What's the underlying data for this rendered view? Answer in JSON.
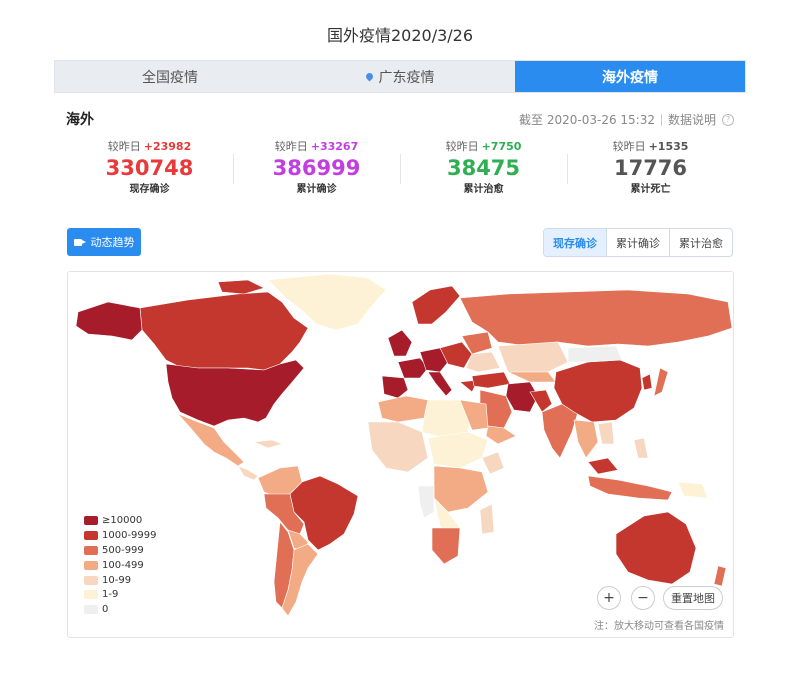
{
  "page_title": "国外疫情2020/3/26",
  "tabs": [
    {
      "label": "全国疫情",
      "active": false
    },
    {
      "label": "广东疫情",
      "active": false,
      "icon": "location-pin-icon"
    },
    {
      "label": "海外疫情",
      "active": true
    }
  ],
  "region_label": "海外",
  "as_of": "截至 2020-03-26 15:32",
  "data_note_link": "数据说明",
  "stats": [
    {
      "change_label": "较昨日",
      "change": "+23982",
      "value": "330748",
      "label": "现存确诊",
      "color": "#e83a3a"
    },
    {
      "change_label": "较昨日",
      "change": "+33267",
      "value": "386999",
      "label": "累计确诊",
      "color": "#c23ee0"
    },
    {
      "change_label": "较昨日",
      "change": "+7750",
      "value": "38475",
      "label": "累计治愈",
      "color": "#2fae52"
    },
    {
      "change_label": "较昨日",
      "change": "+1535",
      "value": "17776",
      "label": "累计死亡",
      "color": "#555555"
    }
  ],
  "trend_button": {
    "label": "动态趋势",
    "icon": "video-camera-icon"
  },
  "map_toggle": [
    {
      "label": "现存确诊",
      "active": true
    },
    {
      "label": "累计确诊",
      "active": false
    },
    {
      "label": "累计治愈",
      "active": false
    }
  ],
  "legend": [
    {
      "label": "≥10000",
      "color": "#a61c2b"
    },
    {
      "label": "1000-9999",
      "color": "#c3372f"
    },
    {
      "label": "500-999",
      "color": "#e06f55"
    },
    {
      "label": "100-499",
      "color": "#f2ab84"
    },
    {
      "label": "10-99",
      "color": "#f7d7c0"
    },
    {
      "label": "1-9",
      "color": "#fdf2d6"
    },
    {
      "label": "0",
      "color": "#efefef"
    }
  ],
  "zoom_in": "+",
  "zoom_out": "−",
  "reset_map": "重置地图",
  "map_note": "注：放大移动可查看各国疫情"
}
